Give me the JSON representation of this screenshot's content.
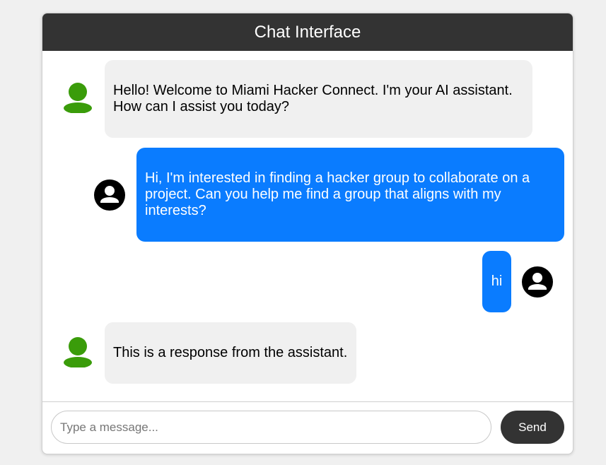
{
  "header": {
    "title": "Chat Interface"
  },
  "colors": {
    "user_bubble": "#0a7cff",
    "assistant_bubble": "#f0f0f0",
    "assistant_avatar": "#3a9c0a",
    "header": "#333333"
  },
  "messages": [
    {
      "role": "assistant",
      "avatar_icon": "person-icon",
      "text": "Hello! Welcome to Miami Hacker Connect. I'm your AI assistant. How can I assist you today?"
    },
    {
      "role": "user",
      "avatar_icon": "account-circle-icon",
      "text": "Hi, I'm interested in finding a hacker group to collaborate on a project. Can you help me find a group that aligns with my interests?"
    },
    {
      "role": "user",
      "avatar_icon": "account-circle-icon",
      "text": "hi"
    },
    {
      "role": "assistant",
      "avatar_icon": "person-icon",
      "text": "This is a response from the assistant."
    }
  ],
  "composer": {
    "placeholder": "Type a message...",
    "value": "",
    "send_label": "Send"
  }
}
